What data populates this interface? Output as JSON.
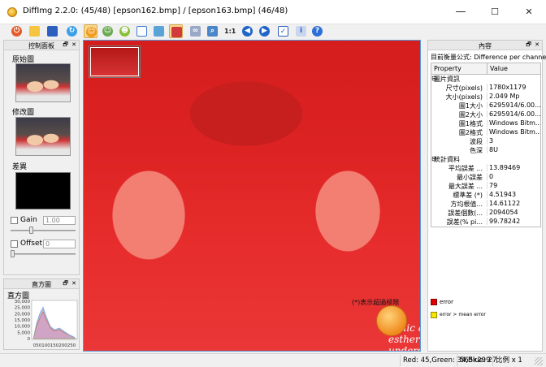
{
  "window": {
    "title": "DiffImg 2.2.0:  (45/48) [epson162.bmp] / [epson163.bmp] (46/48)",
    "minimize": "—",
    "maximize": "☐",
    "close": "✕"
  },
  "toolbar": {
    "icons": [
      "power-icon",
      "open-folder-icon",
      "save-icon",
      "refresh-icon",
      "smiley-icon",
      "smiley-green-icon",
      "smiley-side-icon",
      "layout-icon",
      "image-icon",
      "diff-image-icon",
      "link-icon",
      "zoom-icon",
      "one-to-one-icon",
      "prev-icon",
      "next-icon",
      "checklist-icon",
      "info-icon",
      "help-icon"
    ],
    "one_to_one_label": "1:1"
  },
  "left_panel": {
    "title": "控制面板",
    "header_btns": "🗗 ✕",
    "original_label": "原始圖",
    "modified_label": "修改圖",
    "diff_label": "差異",
    "gain_label": "Gain",
    "gain_value": "1.00",
    "offset_label": "Offset",
    "offset_value": "0",
    "gain_slider_level": 0.3,
    "offset_slider_level": 0.0
  },
  "histogram_panel": {
    "title": "直方圖",
    "header_btns": "🗗 ✕",
    "y_ticks": [
      "30,000",
      "25,000",
      "20,000",
      "15,000",
      "10,000",
      "5,000",
      "0"
    ],
    "x_ticks": "050100150200250",
    "colors": {
      "red": "#e35a5a",
      "green": "#7fbf7f",
      "blue": "#7f8fff"
    }
  },
  "viewer": {
    "legend_title": "(*)表示超過極限",
    "legend_error": "error",
    "legend_mean_error": "error > mean error",
    "watermark": "malic & esther's underdog",
    "error_color": "#e00000",
    "mean_error_color": "#f5e600"
  },
  "right_panel": {
    "title": "內容",
    "header_btns": "🗗 ✕",
    "formula": "目前衡量公式: Difference per channel",
    "col_property": "Property",
    "col_value": "Value",
    "group1": "圖片資訊",
    "group2": "統計資料",
    "rows1": [
      {
        "k": "尺寸(pixels)",
        "v": "1780x1179"
      },
      {
        "k": "大小(pixels)",
        "v": "2.049 Mp"
      },
      {
        "k": "圖1大小",
        "v": "6295914/6.00..."
      },
      {
        "k": "圖2大小",
        "v": "6295914/6.00..."
      },
      {
        "k": "圖1格式",
        "v": "Windows Bitm..."
      },
      {
        "k": "圖2格式",
        "v": "Windows Bitm..."
      },
      {
        "k": "波段",
        "v": "3"
      },
      {
        "k": "色深",
        "v": "8U"
      }
    ],
    "rows2": [
      {
        "k": "平均誤差 ...",
        "v": "13.89469"
      },
      {
        "k": "最小誤差",
        "v": "0"
      },
      {
        "k": "最大誤差 ...",
        "v": "79"
      },
      {
        "k": "標準差 (*)",
        "v": "4.51943"
      },
      {
        "k": "方均根值...",
        "v": "14.61122"
      },
      {
        "k": "誤差個數(...",
        "v": "2094054"
      },
      {
        "k": "誤差(% pi...",
        "v": "99.78242"
      }
    ]
  },
  "statusbar": {
    "pixel": "Red: 45,Green: 34,Blue: 27",
    "size": "565x299",
    "zoom": "比例 x  1"
  }
}
